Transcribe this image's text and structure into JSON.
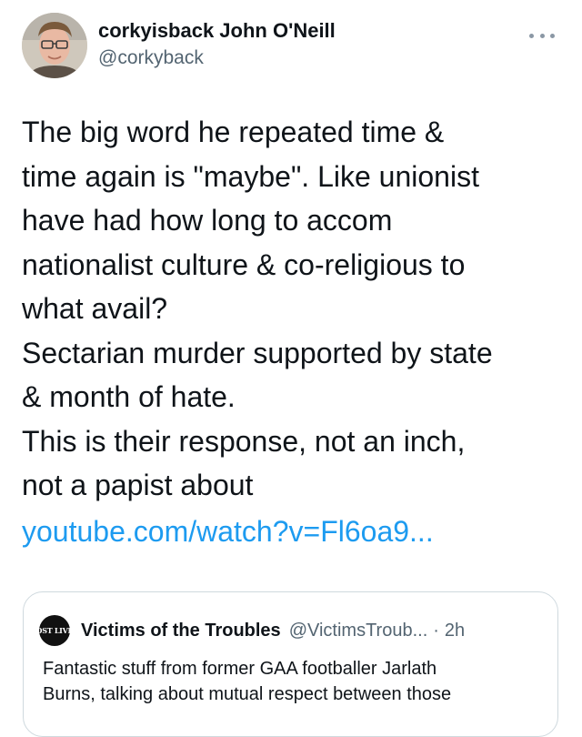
{
  "author": {
    "display_name": "corkyisback John O'Neill",
    "handle": "@corkyback",
    "avatar_icon": "user-avatar-photo",
    "more_icon": "more-options-icon"
  },
  "tweet": {
    "lines": [
      "The big word he repeated time &",
      "time again is \"maybe\". Like unionist",
      "have had how long to accom",
      "nationalist culture & co-religious to",
      "what avail?",
      "Sectarian murder supported by state",
      "& month of hate.",
      "This is their response, not an inch,",
      "not a papist about"
    ],
    "link": "youtube.com/watch?v=Fl6oa9..."
  },
  "quoted_tweet": {
    "avatar_label": "LOST LIVES",
    "display_name": "Victims of the Troubles",
    "handle": "@VictimsTroub...",
    "separator": "·",
    "time": "2h",
    "lines": [
      "Fantastic stuff from former GAA footballer Jarlath",
      "Burns, talking about mutual respect between those"
    ]
  },
  "colors": {
    "text": "#0f1419",
    "secondary": "#536471",
    "link": "#1d9bf0",
    "border": "#cfd9de"
  }
}
